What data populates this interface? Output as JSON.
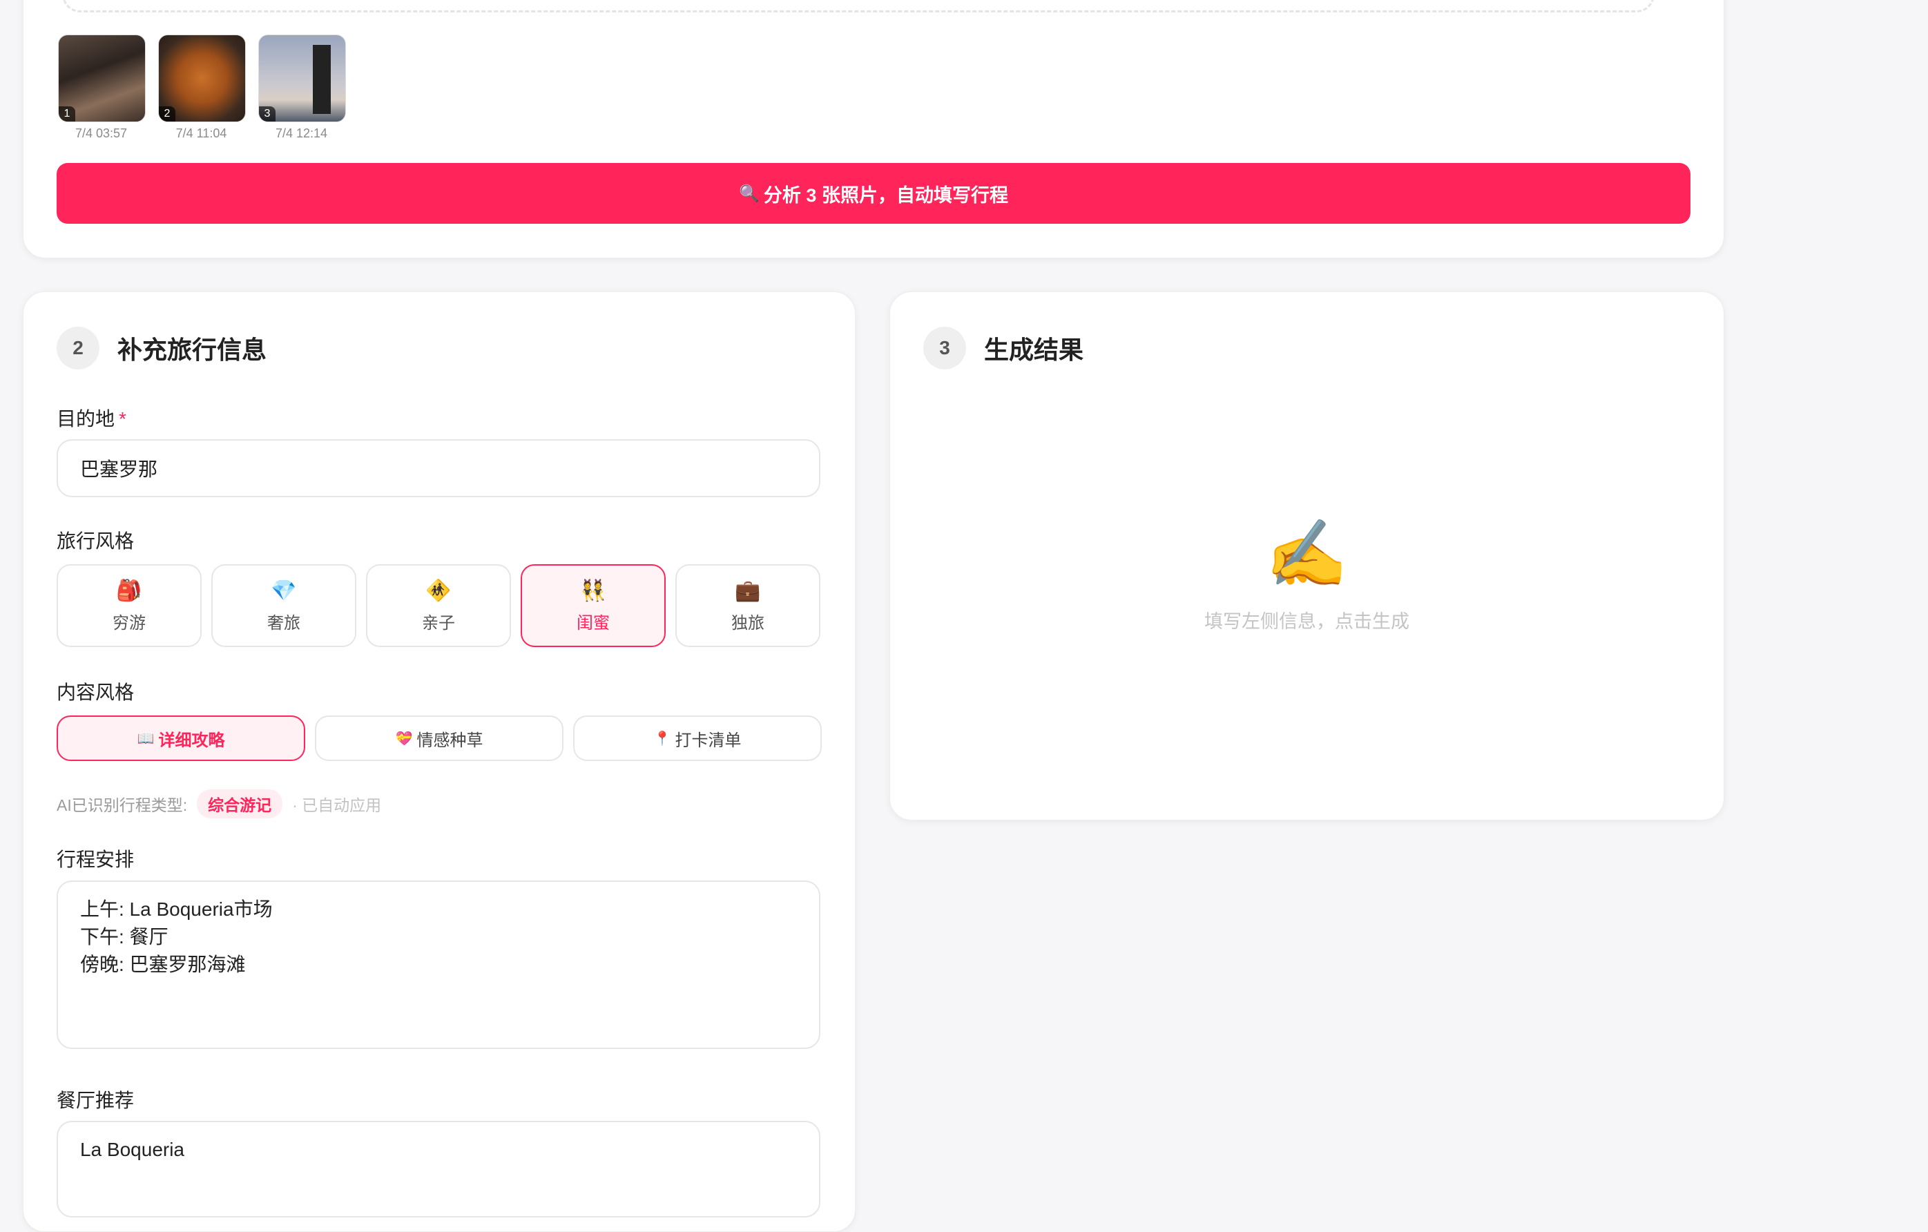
{
  "photos": [
    {
      "num": "1",
      "time": "7/4 03:57"
    },
    {
      "num": "2",
      "time": "7/4 11:04"
    },
    {
      "num": "3",
      "time": "7/4 12:14"
    }
  ],
  "analyze_button": {
    "icon": "🔍",
    "label": "分析 3 张照片，自动填写行程"
  },
  "form": {
    "step": "2",
    "title": "补充旅行信息",
    "destination": {
      "label": "目的地",
      "required_mark": "*",
      "value": "巴塞罗那"
    },
    "travel_style": {
      "label": "旅行风格",
      "options": [
        {
          "emoji": "🎒",
          "label": "穷游"
        },
        {
          "emoji": "💎",
          "label": "奢旅"
        },
        {
          "emoji": "🚸",
          "label": "亲子"
        },
        {
          "emoji": "👯",
          "label": "闺蜜"
        },
        {
          "emoji": "💼",
          "label": "独旅"
        }
      ],
      "selected": "闺蜜"
    },
    "content_style": {
      "label": "内容风格",
      "options": [
        {
          "emoji": "📖",
          "label": "详细攻略"
        },
        {
          "emoji": "💝",
          "label": "情感种草"
        },
        {
          "emoji": "📍",
          "label": "打卡清单"
        }
      ],
      "selected": "详细攻略"
    },
    "ai_detect": {
      "prefix": "AI已识别行程类型:",
      "tag": "综合游记",
      "note": "· 已自动应用"
    },
    "itinerary": {
      "label": "行程安排",
      "value": "上午: La Boqueria市场\n下午: 餐厅\n傍晚: 巴塞罗那海滩"
    },
    "restaurant": {
      "label": "餐厅推荐",
      "value": "La Boqueria"
    }
  },
  "result": {
    "step": "3",
    "title": "生成结果",
    "emoji": "✍️",
    "hint": "填写左侧信息，点击生成"
  },
  "colors": {
    "accent": "#ff2459"
  }
}
